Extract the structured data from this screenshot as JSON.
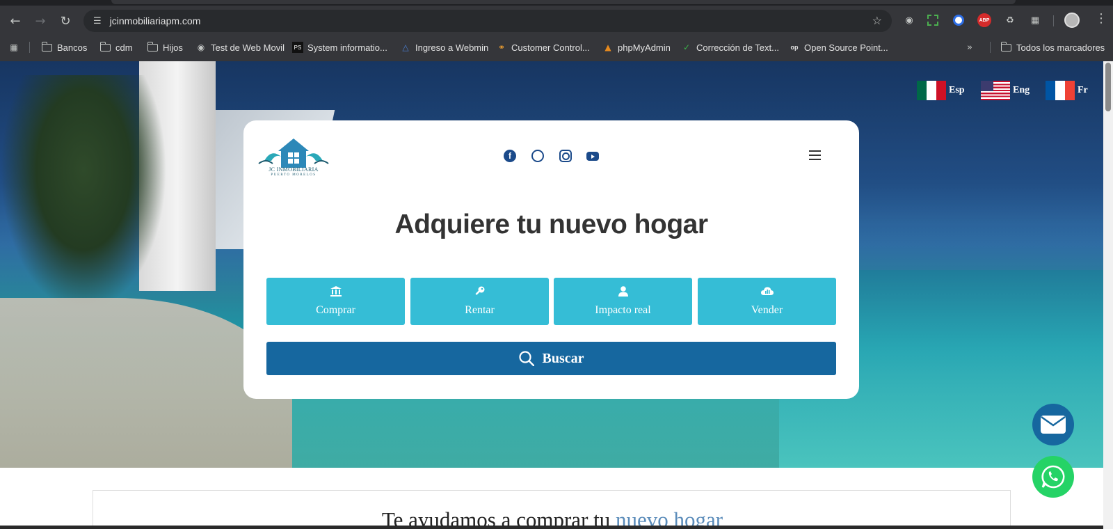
{
  "browser": {
    "url": "jcinmobiliariapm.com",
    "bookmarks": [
      {
        "label": "Bancos",
        "icon": "folder-icon"
      },
      {
        "label": "cdm",
        "icon": "folder-icon"
      },
      {
        "label": "Hijos",
        "icon": "folder-icon"
      },
      {
        "label": "Test de Web Movil",
        "icon": "globe-icon"
      },
      {
        "label": "System informatio...",
        "icon": "psi-icon"
      },
      {
        "label": "Ingreso a Webmin",
        "icon": "webmin-icon"
      },
      {
        "label": "Customer Control...",
        "icon": "cpanel-icon"
      },
      {
        "label": "phpMyAdmin",
        "icon": "phpmyadmin-icon"
      },
      {
        "label": "Corrección de Text...",
        "icon": "checkmark-icon"
      },
      {
        "label": "Open Source Point...",
        "icon": "osp-icon"
      }
    ],
    "all_bookmarks": "Todos los marcadores",
    "extensions": {
      "abp": "ABP"
    }
  },
  "languages": [
    {
      "label": "Esp",
      "flag": "mexico-flag"
    },
    {
      "label": "Eng",
      "flag": "usa-flag"
    },
    {
      "label": "Fr",
      "flag": "france-flag"
    }
  ],
  "logo": {
    "name": "JC INMOBILIARIA",
    "sub": "PUERTO MORELOS"
  },
  "hero": {
    "headline": "Adquiere tu nuevo hogar",
    "tiles": [
      {
        "label": "Comprar",
        "icon": "bank-icon"
      },
      {
        "label": "Rentar",
        "icon": "key-icon"
      },
      {
        "label": "Impacto real",
        "icon": "user-icon"
      },
      {
        "label": "Vender",
        "icon": "cloud-chart-icon"
      }
    ],
    "search_label": "Buscar"
  },
  "section": {
    "title_prefix": "Te ayudamos a comprar tu ",
    "title_accent": "nuevo hogar"
  },
  "colors": {
    "tile": "#35bdd6",
    "search": "#16679f",
    "whatsapp": "#25d366",
    "accent_text": "#5b8cba"
  }
}
